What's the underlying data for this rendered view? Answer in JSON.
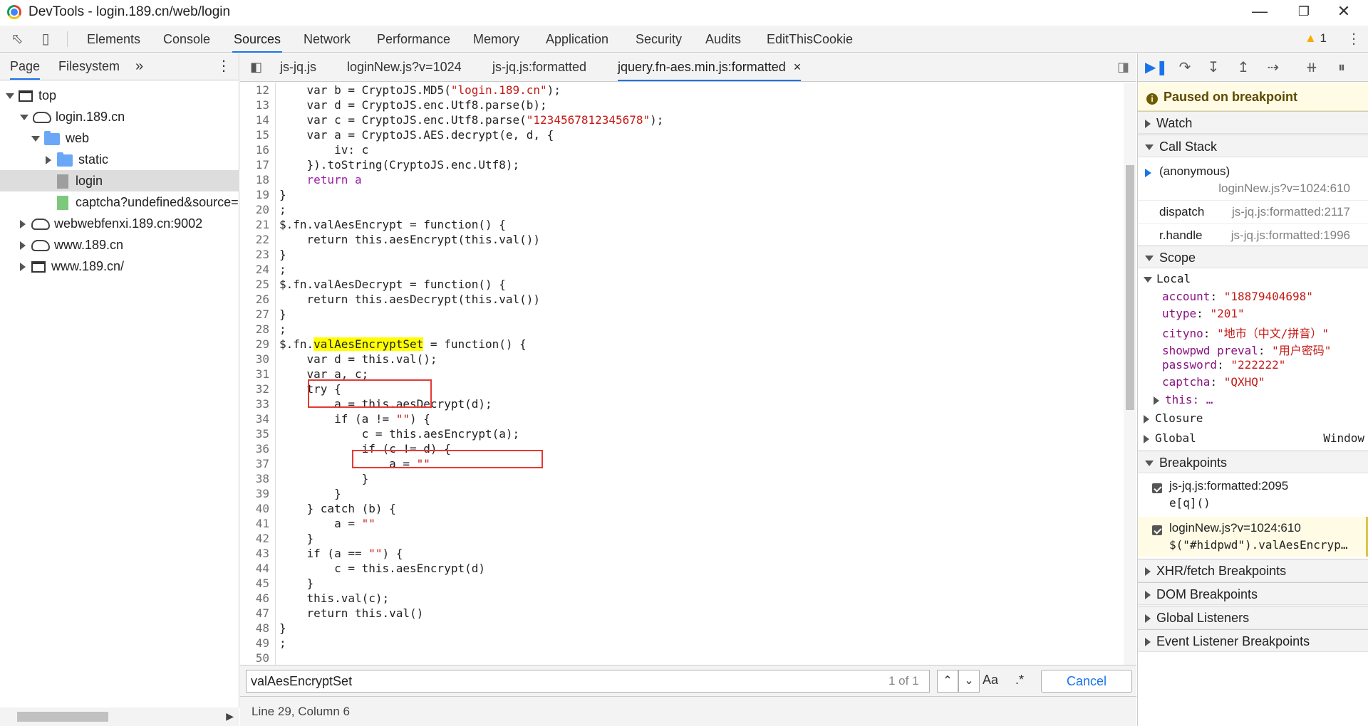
{
  "window": {
    "title": "DevTools - login.189.cn/web/login"
  },
  "toolbar": {
    "tabs": [
      "Elements",
      "Console",
      "Sources",
      "Network",
      "Performance",
      "Memory",
      "Application",
      "Security",
      "Audits",
      "EditThisCookie"
    ],
    "active_tab": "Sources",
    "warnings": "1"
  },
  "navigator": {
    "tabs": [
      "Page",
      "Filesystem"
    ],
    "more": "»",
    "tree": {
      "top": "top",
      "origin": "login.189.cn",
      "web": "web",
      "static": "static",
      "login": "login",
      "captcha": "captcha?undefined&source=",
      "other1": "webwebfenxi.189.cn:9002",
      "other2": "www.189.cn",
      "other3": "www.189.cn/"
    }
  },
  "editor": {
    "tabs": [
      "js-jq.js",
      "loginNew.js?v=1024",
      "js-jq.js:formatted",
      "jquery.fn-aes.min.js:formatted"
    ],
    "active_tab": "jquery.fn-aes.min.js:formatted",
    "close_glyph": "×"
  },
  "code": {
    "l12a": "    var b = CryptoJS.MD5(",
    "l12s": "\"login.189.cn\"",
    "l12b": ");",
    "l13": "    var d = CryptoJS.enc.Utf8.parse(b);",
    "l14a": "    var c = CryptoJS.enc.Utf8.parse(",
    "l14s": "\"1234567812345678\"",
    "l14b": ");",
    "l15": "    var a = CryptoJS.AES.decrypt(e, d, {",
    "l16": "        iv: c",
    "l17": "    }).toString(CryptoJS.enc.Utf8);",
    "l18": "    return a",
    "l19": "}",
    "l20": ";",
    "l21": "$.fn.valAesEncrypt = function() {",
    "l22": "    return this.aesEncrypt(this.val())",
    "l23": "}",
    "l24": ";",
    "l25": "$.fn.valAesDecrypt = function() {",
    "l26": "    return this.aesDecrypt(this.val())",
    "l27": "}",
    "l28": ";",
    "l29a": "$.fn.",
    "l29h": "valAesEncryptSet",
    "l29b": " = function() {",
    "l30": "    var d = this.val();",
    "l31": "    var a, c;",
    "l32": "    try {",
    "l33": "        a = this.aesDecrypt(d);",
    "l34a": "        if (a != ",
    "l34s": "\"\"",
    "l34b": ") {",
    "l35": "            c = this.aesEncrypt(a);",
    "l36": "            if (c != d) {",
    "l37a": "                a = ",
    "l37s": "\"\"",
    "l38": "            }",
    "l39": "        }",
    "l40": "    } catch (b) {",
    "l41a": "        a = ",
    "l41s": "\"\"",
    "l42": "    }",
    "l43a": "    if (a == ",
    "l43s": "\"\"",
    "l43b": ") {",
    "l44": "        c = this.aesEncrypt(d)",
    "l45": "    }",
    "l46": "    this.val(c);",
    "l47": "    return this.val()",
    "l48": "}",
    "l49": ";",
    "l50": ""
  },
  "line_numbers": [
    "12",
    "13",
    "14",
    "15",
    "16",
    "17",
    "18",
    "19",
    "20",
    "21",
    "22",
    "23",
    "24",
    "25",
    "26",
    "27",
    "28",
    "29",
    "30",
    "31",
    "32",
    "33",
    "34",
    "35",
    "36",
    "37",
    "38",
    "39",
    "40",
    "41",
    "42",
    "43",
    "44",
    "45",
    "46",
    "47",
    "48",
    "49",
    "50"
  ],
  "search": {
    "value": "valAesEncryptSet",
    "count": "1 of 1",
    "case_label": "Aa",
    "regex_label": ".*",
    "cancel": "Cancel"
  },
  "status": {
    "position": "Line 29, Column 6"
  },
  "debugger": {
    "paused": "Paused on breakpoint",
    "watch": "Watch",
    "call_stack": "Call Stack",
    "frames": [
      {
        "name": "(anonymous)",
        "loc": "loginNew.js?v=1024:610"
      },
      {
        "name": "dispatch",
        "loc": "js-jq.js:formatted:2117"
      },
      {
        "name": "r.handle",
        "loc": "js-jq.js:formatted:1996"
      }
    ],
    "scope": "Scope",
    "local": "Local",
    "vars": [
      {
        "k": "account",
        "v": "\"18879404698\""
      },
      {
        "k": "utype",
        "v": "\"201\""
      },
      {
        "k": "cityno",
        "v": "\"地市（中文/拼音）\""
      },
      {
        "k": "showpwd_preval",
        "v": "\"用户密码\""
      },
      {
        "k": "password",
        "v": "\"222222\""
      },
      {
        "k": "captcha",
        "v": "\"QXHQ\""
      }
    ],
    "this_label": "this: …",
    "closure": "Closure",
    "global": "Global",
    "global_val": "Window",
    "breakpoints": "Breakpoints",
    "bps": [
      {
        "file": "js-jq.js:formatted:2095",
        "code": "e[q]()"
      },
      {
        "file": "loginNew.js?v=1024:610",
        "code": "$(\"#hidpwd\").valAesEncryp…"
      }
    ],
    "xhr": "XHR/fetch Breakpoints",
    "dom": "DOM Breakpoints",
    "global_listeners": "Global Listeners",
    "event_listener": "Event Listener Breakpoints"
  }
}
